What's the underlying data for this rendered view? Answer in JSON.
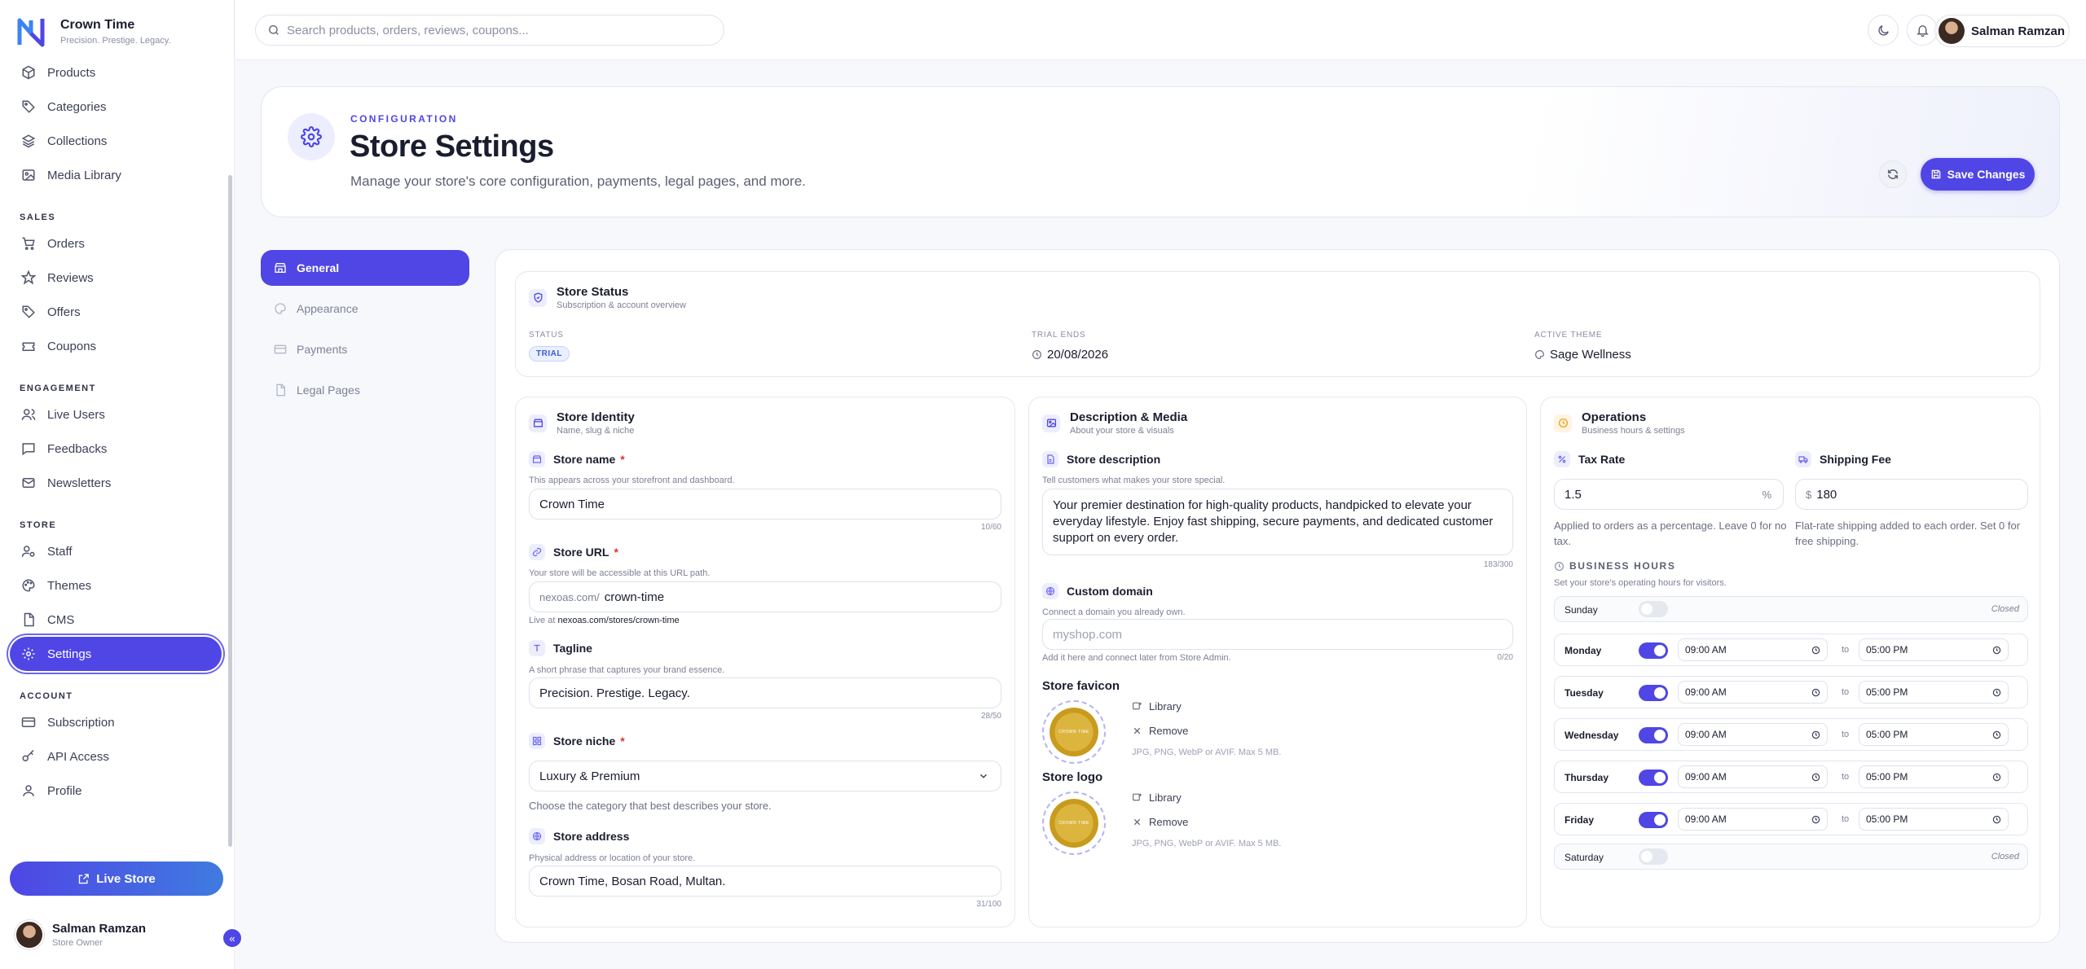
{
  "brand": {
    "name": "Crown Time",
    "tagline": "Precision. Prestige. Legacy."
  },
  "sidebar": {
    "top_items": [
      {
        "label": "Products",
        "icon": "box-icon"
      },
      {
        "label": "Categories",
        "icon": "tag-icon"
      },
      {
        "label": "Collections",
        "icon": "layers-icon"
      },
      {
        "label": "Media Library",
        "icon": "image-icon"
      }
    ],
    "sections": [
      {
        "title": "SALES",
        "items": [
          {
            "label": "Orders"
          },
          {
            "label": "Reviews"
          },
          {
            "label": "Offers"
          },
          {
            "label": "Coupons"
          }
        ]
      },
      {
        "title": "ENGAGEMENT",
        "items": [
          {
            "label": "Live Users"
          },
          {
            "label": "Feedbacks"
          },
          {
            "label": "Newsletters"
          }
        ]
      },
      {
        "title": "STORE",
        "items": [
          {
            "label": "Staff"
          },
          {
            "label": "Themes"
          },
          {
            "label": "CMS"
          },
          {
            "label": "Settings"
          }
        ]
      },
      {
        "title": "ACCOUNT",
        "items": [
          {
            "label": "Subscription"
          },
          {
            "label": "API Access"
          },
          {
            "label": "Profile"
          }
        ]
      }
    ],
    "live_store_label": "Live Store",
    "user": {
      "name": "Salman Ramzan",
      "role": "Store Owner"
    }
  },
  "topbar": {
    "search_placeholder": "Search products, orders, reviews, coupons...",
    "user_name": "Salman Ramzan"
  },
  "header": {
    "eyebrow": "CONFIGURATION",
    "title": "Store Settings",
    "subtitle": "Manage your store's core configuration, payments, legal pages, and more.",
    "save_label": "Save Changes"
  },
  "tabs": [
    "General",
    "Appearance",
    "Payments",
    "Legal Pages"
  ],
  "status_card": {
    "title": "Store Status",
    "subtitle": "Subscription & account overview",
    "status_label": "STATUS",
    "status_value": "TRIAL",
    "trial_label": "TRIAL ENDS",
    "trial_value": "20/08/2026",
    "theme_label": "ACTIVE THEME",
    "theme_value": "Sage Wellness"
  },
  "identity": {
    "title": "Store Identity",
    "subtitle": "Name, slug & niche",
    "name_label": "Store name",
    "name_help": "This appears across your storefront and dashboard.",
    "name_value": "Crown Time",
    "name_count": "10/60",
    "url_label": "Store URL",
    "url_help": "Your store will be accessible at this URL path.",
    "url_prefix": "nexoas.com/",
    "url_value": "crown-time",
    "url_live_prefix": "Live at",
    "url_live": "nexoas.com/stores/crown-time",
    "tagline_label": "Tagline",
    "tagline_help": "A short phrase that captures your brand essence.",
    "tagline_value": "Precision. Prestige. Legacy.",
    "tagline_count": "28/50",
    "niche_label": "Store niche",
    "niche_value": "Luxury & Premium",
    "niche_help": "Choose the category that best describes your store.",
    "address_label": "Store address",
    "address_help": "Physical address or location of your store.",
    "address_value": "Crown Time, Bosan Road, Multan.",
    "address_count": "31/100"
  },
  "media": {
    "title": "Description & Media",
    "subtitle": "About your store & visuals",
    "desc_label": "Store description",
    "desc_help": "Tell customers what makes your store special.",
    "desc_value": "Your premier destination for high-quality products, handpicked to elevate your everyday lifestyle. Enjoy fast shipping, secure payments, and dedicated customer support on every order.",
    "desc_count": "183/300",
    "domain_label": "Custom domain",
    "domain_help": "Connect a domain you already own.",
    "domain_placeholder": "myshop.com",
    "domain_note": "Add it here and connect later from Store Admin.",
    "domain_count": "0/20",
    "favicon_title": "Store favicon",
    "logo_title": "Store logo",
    "library_label": "Library",
    "remove_label": "Remove",
    "formats": "JPG, PNG, WebP or AVIF. Max 5 MB.",
    "medal_text": "CROWN TIME"
  },
  "operations": {
    "title": "Operations",
    "subtitle": "Business hours & settings",
    "tax_label": "Tax Rate",
    "tax_value": "1.5",
    "tax_suffix": "%",
    "tax_help": "Applied to orders as a percentage. Leave 0 for no tax.",
    "ship_label": "Shipping Fee",
    "ship_prefix": "$",
    "ship_value": "180",
    "ship_help": "Flat-rate shipping added to each order. Set 0 for free shipping.",
    "hours_title": "BUSINESS HOURS",
    "hours_help": "Set your store's operating hours for visitors.",
    "to_label": "to",
    "closed_label": "Closed",
    "days": [
      {
        "name": "Sunday",
        "open": false,
        "from": "",
        "to": ""
      },
      {
        "name": "Monday",
        "open": true,
        "from": "09:00 AM",
        "to": "05:00 PM"
      },
      {
        "name": "Tuesday",
        "open": true,
        "from": "09:00 AM",
        "to": "05:00 PM"
      },
      {
        "name": "Wednesday",
        "open": true,
        "from": "09:00 AM",
        "to": "05:00 PM"
      },
      {
        "name": "Thursday",
        "open": true,
        "from": "09:00 AM",
        "to": "05:00 PM"
      },
      {
        "name": "Friday",
        "open": true,
        "from": "09:00 AM",
        "to": "05:00 PM"
      },
      {
        "name": "Saturday",
        "open": false,
        "from": "",
        "to": ""
      }
    ]
  }
}
